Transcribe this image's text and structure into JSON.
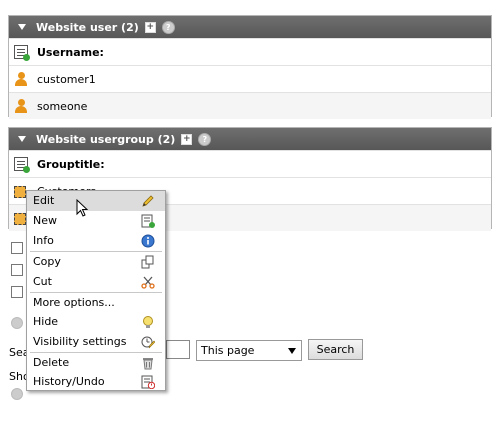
{
  "user_panel": {
    "header": "Website user (2)",
    "column": "Username:",
    "rows": [
      "customer1",
      "someone"
    ]
  },
  "group_panel": {
    "header": "Website usergroup (2)",
    "column": "Grouptitle:",
    "rows": [
      "Customers",
      ""
    ]
  },
  "search": {
    "label_fragment": "Sea",
    "scope_value": "This page",
    "button": "Search"
  },
  "show_fragment": "Sho",
  "context_menu": {
    "items": [
      {
        "label": "Edit",
        "icon": "pencil-icon"
      },
      {
        "label": "New",
        "icon": "new-record-icon"
      },
      {
        "label": "Info",
        "icon": "info-icon"
      },
      {
        "label": "Copy",
        "icon": "copy-icon"
      },
      {
        "label": "Cut",
        "icon": "scissors-icon"
      },
      {
        "label": "More options...",
        "icon": ""
      },
      {
        "label": "Hide",
        "icon": "lightbulb-icon"
      },
      {
        "label": "Visibility settings",
        "icon": "visibility-settings-icon"
      },
      {
        "label": "Delete",
        "icon": "trash-icon"
      },
      {
        "label": "History/Undo",
        "icon": "history-icon"
      }
    ],
    "highlighted": "Edit"
  }
}
